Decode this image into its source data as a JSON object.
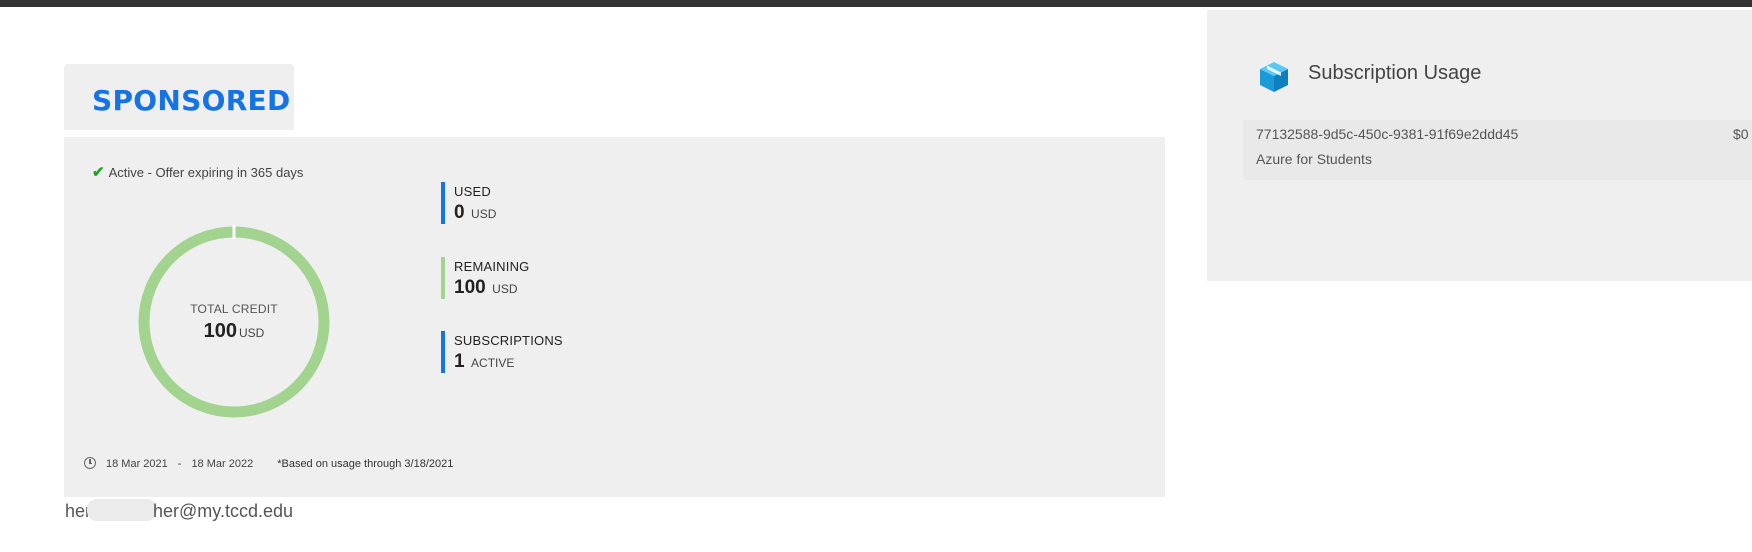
{
  "offer": {
    "tab_title": "SPONSORED",
    "status": "Active - Offer expiring in 365 days",
    "total_credit_label": "TOTAL CREDIT",
    "total_credit_value": "100",
    "total_credit_unit": "USD",
    "donut_used_fraction": 0.0,
    "colors": {
      "remaining": "#a2d490",
      "used": "#1473e6",
      "accent": "#1473e6"
    },
    "stats": [
      {
        "label": "USED",
        "value": "0",
        "unit": "USD",
        "color": "#1473e6"
      },
      {
        "label": "REMAINING",
        "value": "100",
        "unit": "USD",
        "color": "#a2d490"
      },
      {
        "label": "SUBSCRIPTIONS",
        "value": "1",
        "unit": "ACTIVE",
        "color": "#1473e6"
      }
    ],
    "date_start": "18 Mar 2021",
    "date_separator": "-",
    "date_end": "18 Mar 2022",
    "usage_note": "*Based on usage through 3/18/2021",
    "icons": {
      "status": "checkmark-icon",
      "dates": "clock-icon"
    }
  },
  "account": {
    "email_prefix": "her",
    "email_suffix": "her@my.tccd.edu"
  },
  "subscription_usage": {
    "title": "Subscription Usage",
    "icon": "cube-icon",
    "items": [
      {
        "id": "77132588-9d5c-450c-9381-91f69e2ddd45",
        "name": "Azure for Students",
        "cost": "$0"
      }
    ]
  }
}
